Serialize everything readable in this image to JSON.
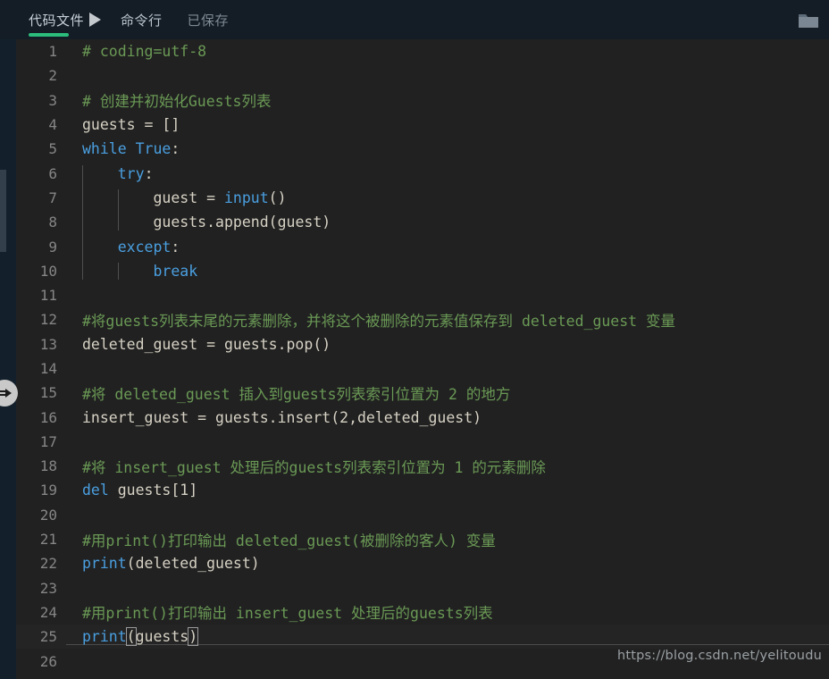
{
  "window": {
    "background": "#212121",
    "header_background": "#141d26",
    "accent": "#2bbb7b"
  },
  "header": {
    "tabs": [
      {
        "label": "代码文件",
        "state": "active",
        "icon": "run-triangle-icon"
      },
      {
        "label": "命令行",
        "state": "inactive"
      },
      {
        "label": "已保存",
        "state": "disabled"
      }
    ],
    "folder_icon": "folder-icon"
  },
  "left_rail": {
    "expand_icon": "arrow-right-expand-icon"
  },
  "watermark": "https://blog.csdn.net/yelitoudu",
  "editor": {
    "language": "python",
    "current_line": 25,
    "total_lines_visible": 26,
    "lines": [
      {
        "n": 1,
        "text": "# coding=utf-8"
      },
      {
        "n": 2,
        "text": ""
      },
      {
        "n": 3,
        "text": "# 创建并初始化Guests列表"
      },
      {
        "n": 4,
        "text": "guests = []"
      },
      {
        "n": 5,
        "text": "while True:"
      },
      {
        "n": 6,
        "text": "    try:"
      },
      {
        "n": 7,
        "text": "        guest = input()"
      },
      {
        "n": 8,
        "text": "        guests.append(guest)"
      },
      {
        "n": 9,
        "text": "    except:"
      },
      {
        "n": 10,
        "text": "        break"
      },
      {
        "n": 11,
        "text": ""
      },
      {
        "n": 12,
        "text": "#将guests列表末尾的元素删除，并将这个被删除的元素值保存到 deleted_guest 变量"
      },
      {
        "n": 13,
        "text": "deleted_guest = guests.pop()"
      },
      {
        "n": 14,
        "text": ""
      },
      {
        "n": 15,
        "text": "#将 deleted_guest 插入到guests列表索引位置为 2 的地方"
      },
      {
        "n": 16,
        "text": "insert_guest = guests.insert(2,deleted_guest)"
      },
      {
        "n": 17,
        "text": ""
      },
      {
        "n": 18,
        "text": "#将 insert_guest 处理后的guests列表索引位置为 1 的元素删除"
      },
      {
        "n": 19,
        "text": "del guests[1]"
      },
      {
        "n": 20,
        "text": ""
      },
      {
        "n": 21,
        "text": "#用print()打印输出 deleted_guest(被删除的客人) 变量"
      },
      {
        "n": 22,
        "text": "print(deleted_guest)"
      },
      {
        "n": 23,
        "text": ""
      },
      {
        "n": 24,
        "text": "#用print()打印输出 insert_guest 处理后的guests列表"
      },
      {
        "n": 25,
        "text": "print(guests)"
      },
      {
        "n": 26,
        "text": ""
      }
    ],
    "tokens": {
      "comment_color": "#6a9955",
      "keyword_color": "#4a9fe0",
      "identifier_color": "#d6d1c4"
    }
  }
}
